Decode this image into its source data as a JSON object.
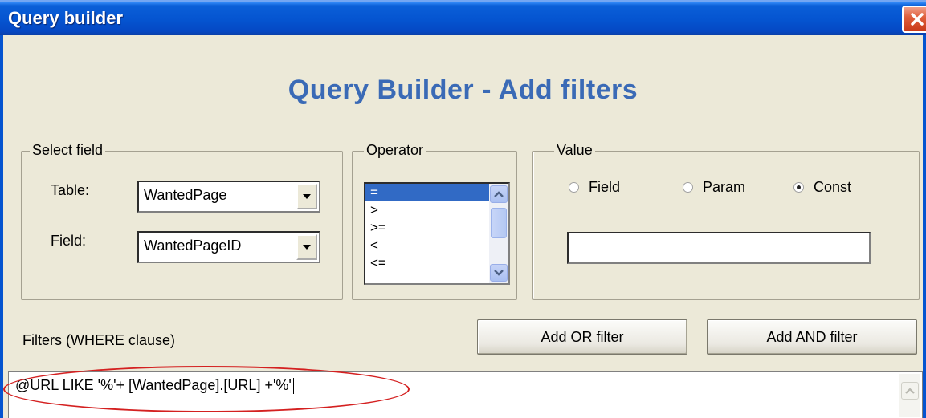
{
  "window": {
    "title": "Query builder"
  },
  "heading": "Query Builder - Add filters",
  "select_field": {
    "legend": "Select field",
    "table_label": "Table:",
    "table_value": "WantedPage",
    "field_label": "Field:",
    "field_value": "WantedPageID"
  },
  "operator": {
    "legend": "Operator",
    "items": [
      "=",
      ">",
      ">=",
      "<",
      "<="
    ],
    "selected": "="
  },
  "value": {
    "legend": "Value",
    "radios": [
      {
        "label": "Field",
        "checked": false
      },
      {
        "label": "Param",
        "checked": false
      },
      {
        "label": "Const",
        "checked": true
      }
    ],
    "input_value": ""
  },
  "filters": {
    "label": "Filters (WHERE clause)",
    "add_or_label": "Add OR filter",
    "add_and_label": "Add AND filter",
    "text": "@URL LIKE '%'+ [WantedPage].[URL] +'%'"
  },
  "colors": {
    "title_bar": "#0554d0",
    "heading": "#3a6ab6",
    "selection": "#316ac5",
    "annotation": "#d42020"
  }
}
